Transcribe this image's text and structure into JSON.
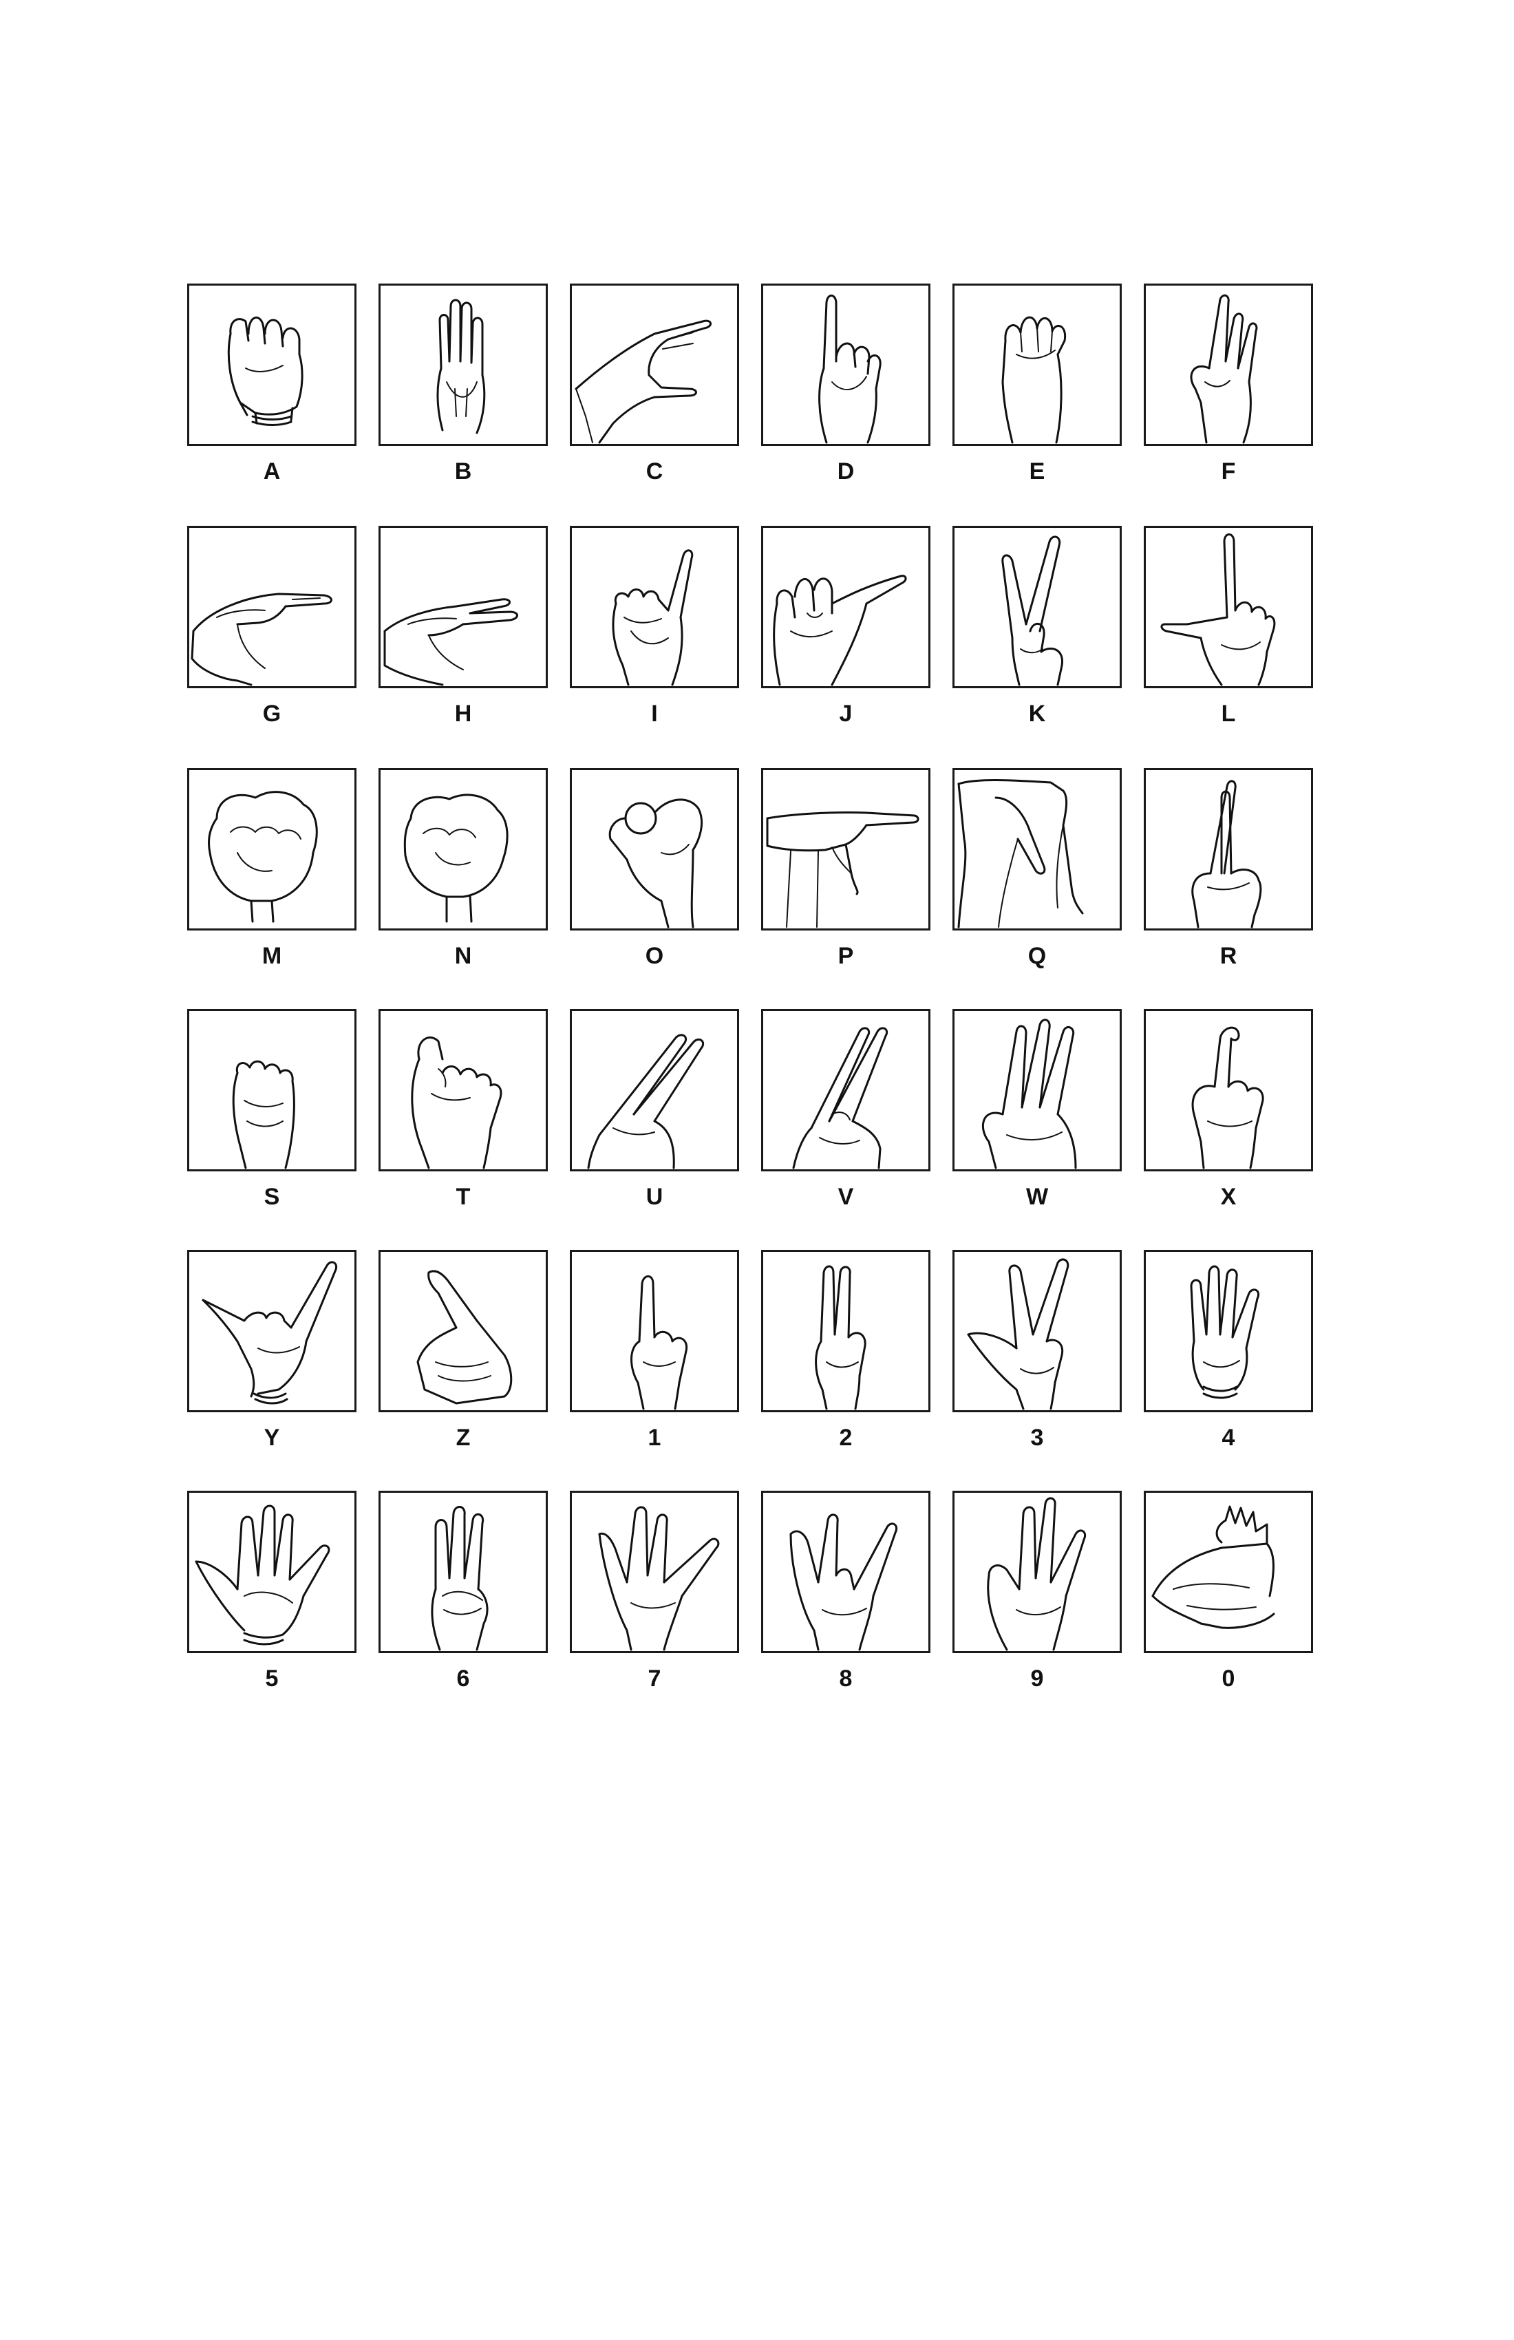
{
  "signs": [
    {
      "label": "A",
      "icon": "hand-fist-thumb-side-icon"
    },
    {
      "label": "B",
      "icon": "hand-flat-fingers-up-icon"
    },
    {
      "label": "C",
      "icon": "hand-curved-c-shape-icon"
    },
    {
      "label": "D",
      "icon": "hand-index-up-circle-icon"
    },
    {
      "label": "E",
      "icon": "hand-fingers-curled-icon"
    },
    {
      "label": "F",
      "icon": "hand-three-fingers-up-icon"
    },
    {
      "label": "G",
      "icon": "hand-index-point-side-icon"
    },
    {
      "label": "H",
      "icon": "hand-two-fingers-side-icon"
    },
    {
      "label": "I",
      "icon": "hand-pinky-up-icon"
    },
    {
      "label": "J",
      "icon": "hand-pinky-hook-icon"
    },
    {
      "label": "K",
      "icon": "hand-two-fingers-thumb-icon"
    },
    {
      "label": "L",
      "icon": "hand-l-shape-icon"
    },
    {
      "label": "M",
      "icon": "hand-fist-m-icon"
    },
    {
      "label": "N",
      "icon": "hand-fist-n-icon"
    },
    {
      "label": "O",
      "icon": "hand-o-circle-icon"
    },
    {
      "label": "P",
      "icon": "hand-pointing-down-icon"
    },
    {
      "label": "Q",
      "icon": "hand-q-shape-icon"
    },
    {
      "label": "R",
      "icon": "hand-crossed-fingers-icon"
    },
    {
      "label": "S",
      "icon": "hand-fist-s-icon"
    },
    {
      "label": "T",
      "icon": "hand-fist-t-icon"
    },
    {
      "label": "U",
      "icon": "hand-two-fingers-together-icon"
    },
    {
      "label": "V",
      "icon": "hand-v-sign-icon"
    },
    {
      "label": "W",
      "icon": "hand-three-fingers-w-icon"
    },
    {
      "label": "X",
      "icon": "hand-hooked-index-icon"
    },
    {
      "label": "Y",
      "icon": "hand-thumb-pinky-out-icon"
    },
    {
      "label": "Z",
      "icon": "hand-index-diagonal-icon"
    },
    {
      "label": "1",
      "icon": "hand-one-finger-icon"
    },
    {
      "label": "2",
      "icon": "hand-two-fingers-icon"
    },
    {
      "label": "3",
      "icon": "hand-three-with-thumb-icon"
    },
    {
      "label": "4",
      "icon": "hand-four-fingers-icon"
    },
    {
      "label": "5",
      "icon": "hand-open-palm-icon"
    },
    {
      "label": "6",
      "icon": "hand-three-fingers-six-icon"
    },
    {
      "label": "7",
      "icon": "hand-seven-icon"
    },
    {
      "label": "8",
      "icon": "hand-eight-icon"
    },
    {
      "label": "9",
      "icon": "hand-nine-icon"
    },
    {
      "label": "0",
      "icon": "hand-zero-icon"
    }
  ]
}
